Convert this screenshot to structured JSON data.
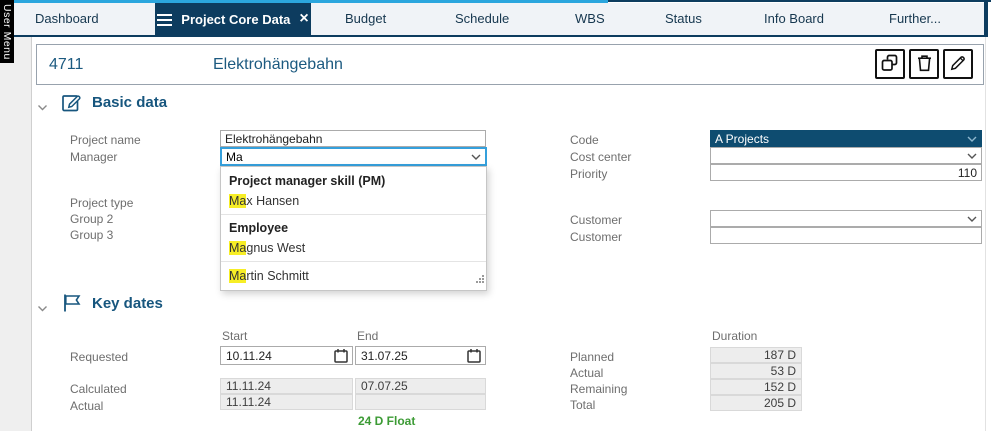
{
  "window": {
    "user_menu_label": "User Menu"
  },
  "colors": {
    "accent_cyan": "#2ba6de",
    "navy": "#0d3c5f",
    "header_blue": "#1c5a80",
    "code_select_bg": "#0e4c70",
    "highlight_yellow": "#f7ee26",
    "float_green": "#3c9b35"
  },
  "icons": {
    "tab_menu": "hamburger",
    "tab_close": "×",
    "copy": "copy",
    "delete": "trash",
    "edit": "pencil",
    "section_basic": "edit-square",
    "section_dates": "flag",
    "collapse": "chevron-down",
    "calendar": "calendar",
    "resize": "grip-dots"
  },
  "tabs": [
    {
      "label": "Dashboard",
      "active": false
    },
    {
      "label": "Project Core Data",
      "active": true
    },
    {
      "label": "Budget",
      "active": false
    },
    {
      "label": "Schedule",
      "active": false
    },
    {
      "label": "WBS",
      "active": false
    },
    {
      "label": "Status",
      "active": false
    },
    {
      "label": "Info Board",
      "active": false
    },
    {
      "label": "Further...",
      "active": false
    }
  ],
  "header": {
    "project_id": "4711",
    "project_name": "Elektrohängebahn"
  },
  "basic_data": {
    "title": "Basic data",
    "project_name": {
      "label": "Project name",
      "value": "Elektrohängebahn"
    },
    "manager": {
      "label": "Manager",
      "value": "Ma"
    },
    "project_type": {
      "label": "Project type"
    },
    "group2": {
      "label": "Group 2"
    },
    "group3": {
      "label": "Group 3"
    },
    "code": {
      "label": "Code",
      "value": "A Projects"
    },
    "cost_center": {
      "label": "Cost center",
      "value": ""
    },
    "priority": {
      "label": "Priority",
      "value": "110"
    },
    "customer1": {
      "label": "Customer",
      "value": ""
    },
    "customer2": {
      "label": "Customer",
      "value": ""
    },
    "autocomplete": {
      "query": "Ma",
      "groups": [
        {
          "header": "Project manager skill (PM)",
          "items": [
            {
              "highlight": "Ma",
              "rest": "x Hansen"
            }
          ]
        },
        {
          "header": "Employee",
          "items": [
            {
              "highlight": "Ma",
              "rest": "gnus West"
            },
            {
              "highlight": "Ma",
              "rest": "rtin Schmitt"
            }
          ]
        }
      ]
    }
  },
  "key_dates": {
    "title": "Key dates",
    "col_start": "Start",
    "col_end": "End",
    "col_duration": "Duration",
    "requested": {
      "label": "Requested",
      "start": "10.11.24",
      "end": "31.07.25"
    },
    "calculated": {
      "label": "Calculated",
      "start": "11.11.24",
      "end": "07.07.25"
    },
    "actual": {
      "label": "Actual",
      "start": "11.11.24",
      "end": ""
    },
    "float_note": "24 D Float",
    "durations": [
      {
        "label": "Planned",
        "value": "187 D"
      },
      {
        "label": "Actual",
        "value": "53 D"
      },
      {
        "label": "Remaining",
        "value": "152 D"
      },
      {
        "label": "Total",
        "value": "205 D"
      }
    ]
  }
}
